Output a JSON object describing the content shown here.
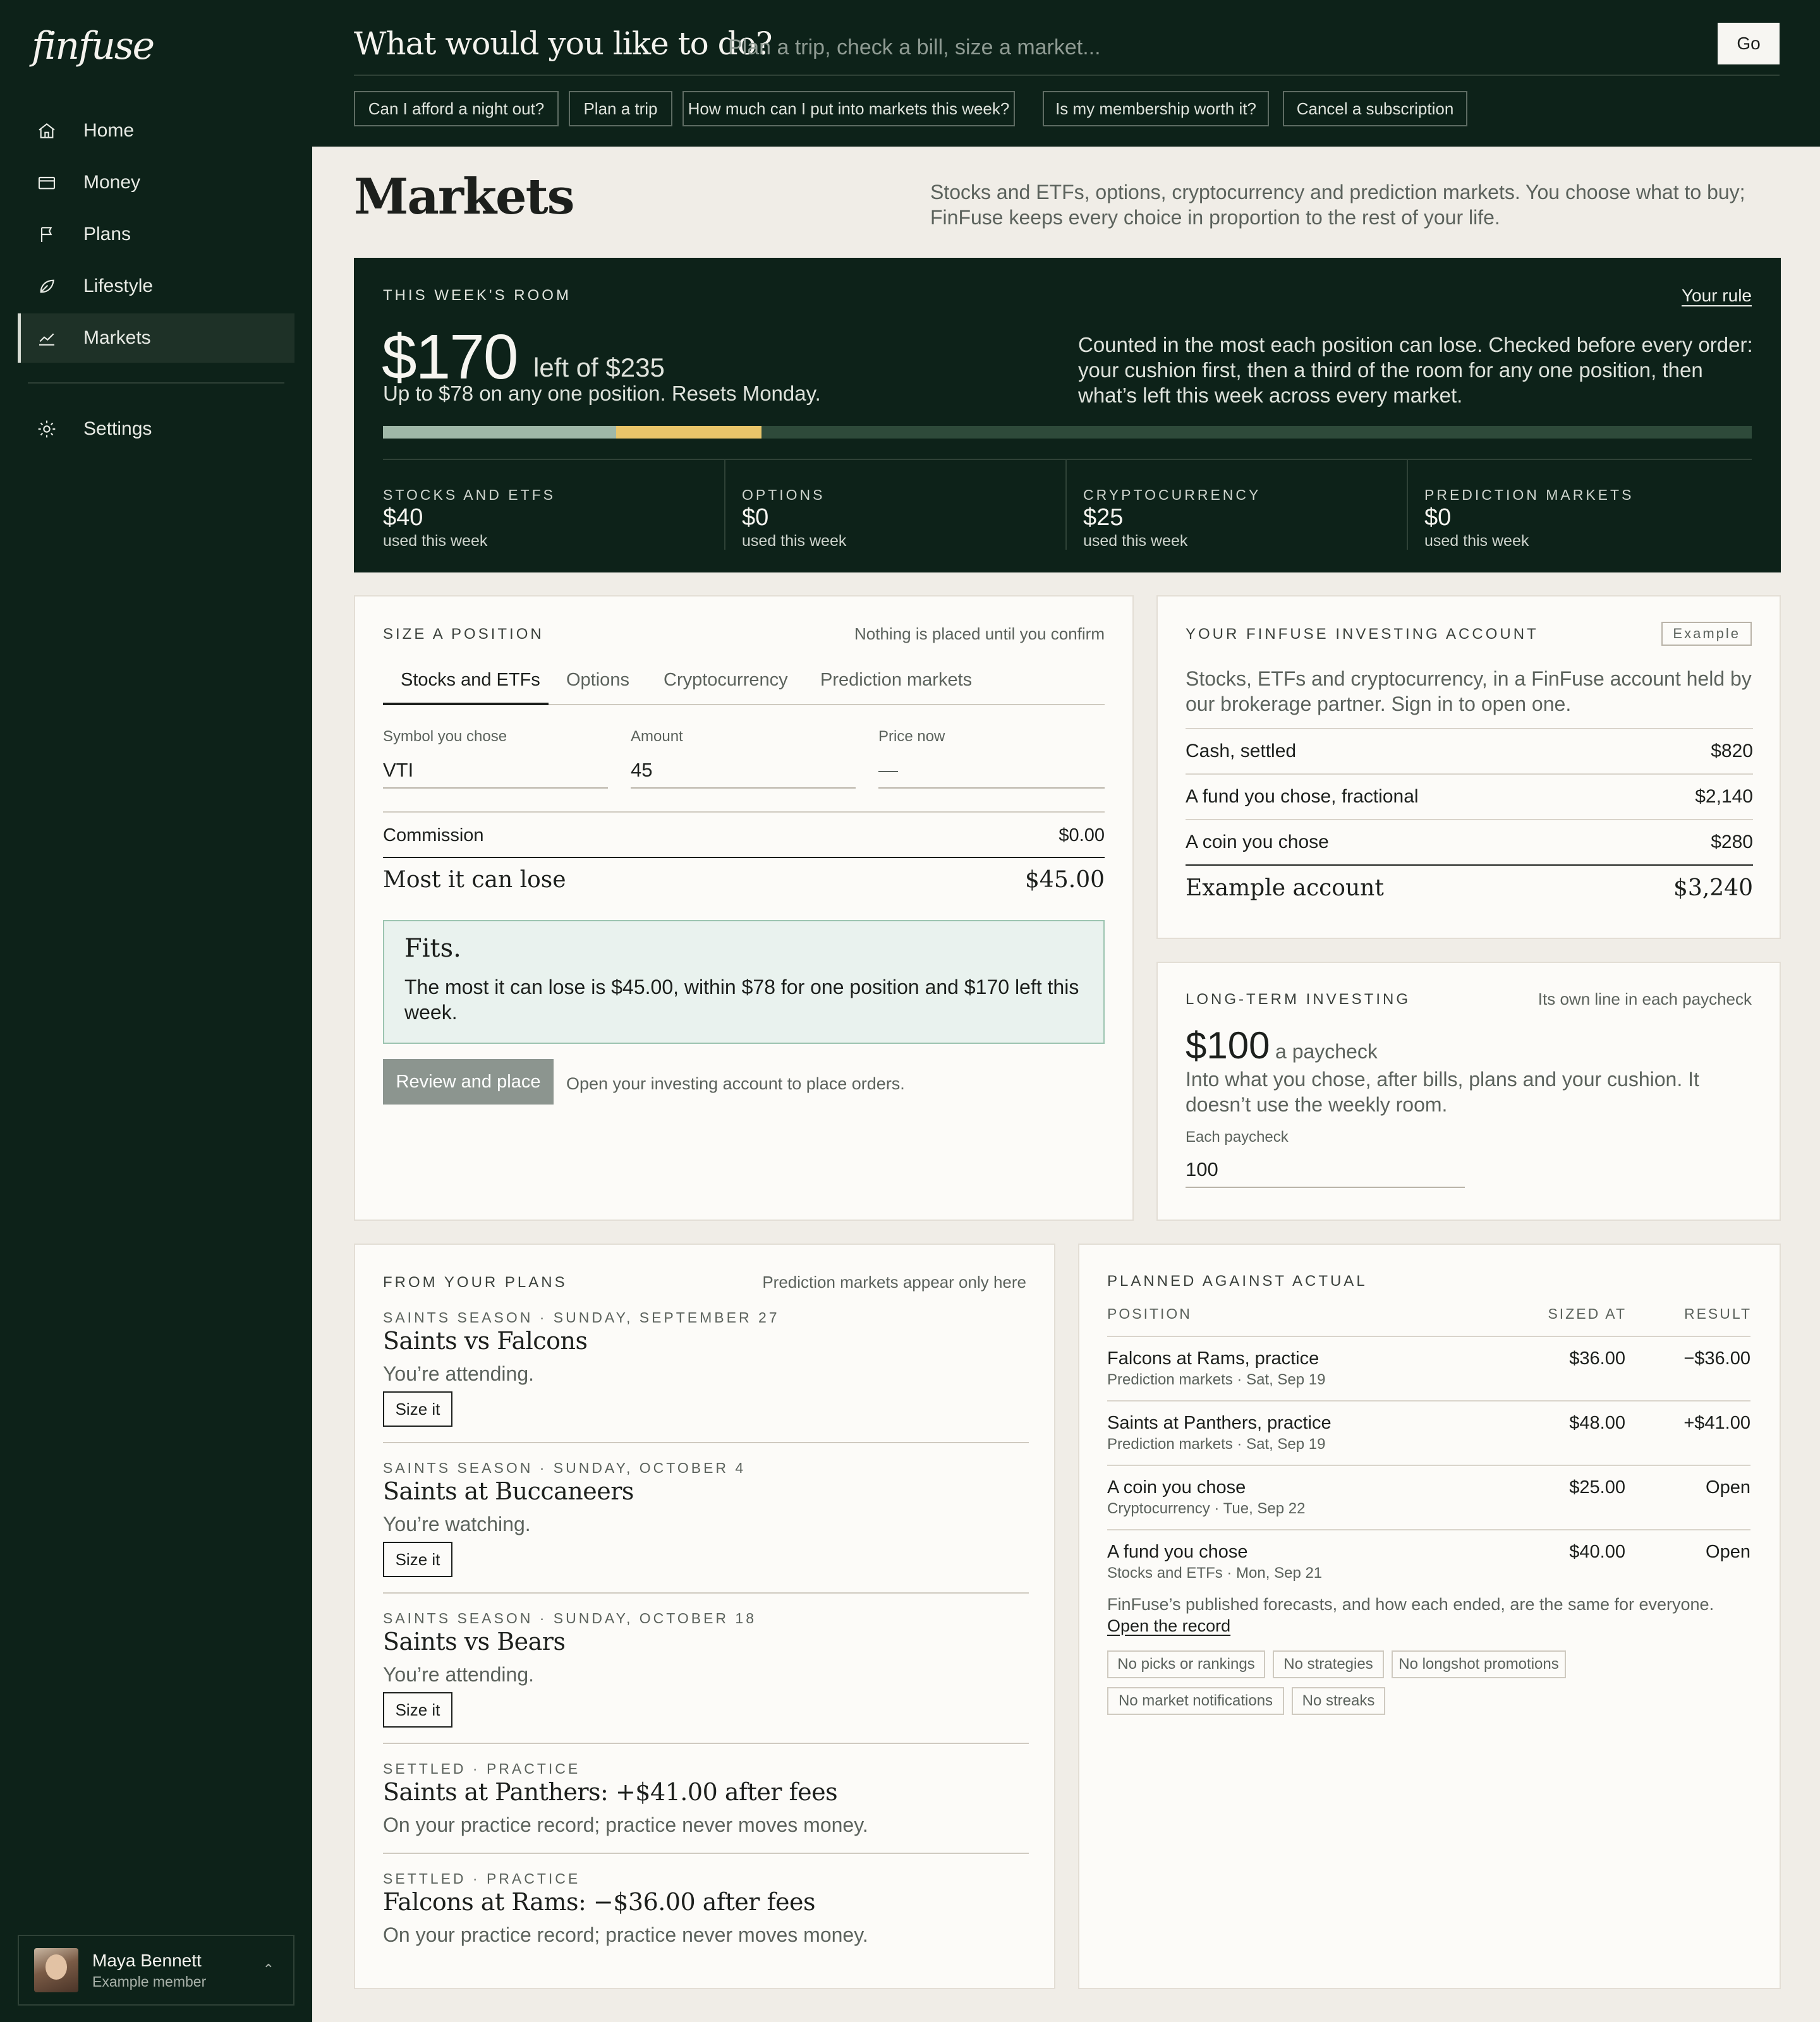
{
  "brand": {
    "logo": "finfuse"
  },
  "nav": {
    "home": "Home",
    "money": "Money",
    "plans": "Plans",
    "lifestyle": "Lifestyle",
    "markets": "Markets",
    "settings": "Settings"
  },
  "user": {
    "name": "Maya Bennett",
    "role": "Example member"
  },
  "ask": {
    "title": "What would you like to do?",
    "placeholder": "Plan a trip, check a bill, size a market...",
    "go": "Go",
    "chips": [
      "Can I afford a night out?",
      "Plan a trip",
      "How much can I put into markets this week?",
      "Is my membership worth it?",
      "Cancel a subscription"
    ]
  },
  "page": {
    "title": "Markets",
    "description": "Stocks and ETFs, options, cryptocurrency and prediction markets. You choose what to buy; FinFuse keeps every choice in proportion to the rest of your life."
  },
  "room": {
    "eyebrow": "This week's room",
    "rule_link": "Your rule",
    "amount": "$170",
    "left_of": "left of $235",
    "sub": "Up to $78 on any one position. Resets Monday.",
    "note": "Counted in the most each position can lose. Checked before every order: your cushion first, then a third of the room for any one position, then what’s left this week across every market.",
    "bar": {
      "total": 235,
      "stocks_used": 40,
      "crypto_used": 25
    },
    "colors": {
      "stocks": "#9fb8a8",
      "crypto": "#e9c56a",
      "track": "#2e4a3a"
    },
    "markets": [
      {
        "label": "Stocks and ETFs",
        "value": "$40",
        "sub": "used this week"
      },
      {
        "label": "Options",
        "value": "$0",
        "sub": "used this week"
      },
      {
        "label": "Cryptocurrency",
        "value": "$25",
        "sub": "used this week"
      },
      {
        "label": "Prediction markets",
        "value": "$0",
        "sub": "used this week"
      }
    ]
  },
  "size": {
    "eyebrow": "Size a position",
    "meta": "Nothing is placed until you confirm",
    "tabs": [
      "Stocks and ETFs",
      "Options",
      "Cryptocurrency",
      "Prediction markets"
    ],
    "symbol_label": "Symbol you chose",
    "symbol_value": "VTI",
    "amount_label": "Amount",
    "amount_value": "45",
    "price_label": "Price now",
    "price_value": "—",
    "commission_label": "Commission",
    "commission_value": "$0.00",
    "most_label": "Most it can lose",
    "most_value": "$45.00",
    "fits_title": "Fits.",
    "fits_text": "The most it can lose is $45.00, within $78 for one position and $170 left this week.",
    "review_button": "Review and place",
    "review_note": "Open your investing account to place orders."
  },
  "account": {
    "eyebrow": "Your FinFuse investing account",
    "badge": "Example",
    "desc": "Stocks, ETFs and cryptocurrency, in a FinFuse account held by our brokerage partner. Sign in to open one.",
    "rows": [
      {
        "label": "Cash, settled",
        "value": "$820"
      },
      {
        "label": "A fund you chose, fractional",
        "value": "$2,140"
      },
      {
        "label": "A coin you chose",
        "value": "$280"
      }
    ],
    "total_label": "Example account",
    "total_value": "$3,240"
  },
  "longterm": {
    "eyebrow": "Long-term investing",
    "meta": "Its own line in each paycheck",
    "amount": "$100",
    "per": "a paycheck",
    "desc": "Into what you chose, after bills, plans and your cushion. It doesn’t use the weekly room.",
    "field_label": "Each paycheck",
    "field_value": "100"
  },
  "plans": {
    "eyebrow": "From your plans",
    "meta": "Prediction markets appear only here",
    "size_button": "Size it",
    "items": [
      {
        "eyebrow": "Saints season · Sunday, September 27",
        "title": "Saints vs Falcons",
        "sub": "You’re attending."
      },
      {
        "eyebrow": "Saints season · Sunday, October 4",
        "title": "Saints at Buccaneers",
        "sub": "You’re watching."
      },
      {
        "eyebrow": "Saints season · Sunday, October 18",
        "title": "Saints vs Bears",
        "sub": "You’re attending."
      },
      {
        "eyebrow": "Settled · Practice",
        "title": "Saints at Panthers: +$41.00 after fees",
        "sub": "On your practice record; practice never moves money."
      },
      {
        "eyebrow": "Settled · Practice",
        "title": "Falcons at Rams: −$36.00 after fees",
        "sub": "On your practice record; practice never moves money."
      }
    ]
  },
  "pva": {
    "eyebrow": "Planned against actual",
    "headers": {
      "position": "Position",
      "sized": "Sized at",
      "result": "Result"
    },
    "rows": [
      {
        "name": "Falcons at Rams, practice",
        "detail": "Prediction markets · Sat, Sep 19",
        "sized": "$36.00",
        "result": "−$36.00"
      },
      {
        "name": "Saints at Panthers, practice",
        "detail": "Prediction markets · Sat, Sep 19",
        "sized": "$48.00",
        "result": "+$41.00"
      },
      {
        "name": "A coin you chose",
        "detail": "Cryptocurrency · Tue, Sep 22",
        "sized": "$25.00",
        "result": "Open"
      },
      {
        "name": "A fund you chose",
        "detail": "Stocks and ETFs · Mon, Sep 21",
        "sized": "$40.00",
        "result": "Open"
      }
    ],
    "footnote": "FinFuse’s published forecasts, and how each ended, are the same for everyone.",
    "footnote_link": "Open the record",
    "tags": [
      "No picks or rankings",
      "No strategies",
      "No longshot promotions",
      "No market notifications",
      "No streaks"
    ]
  }
}
